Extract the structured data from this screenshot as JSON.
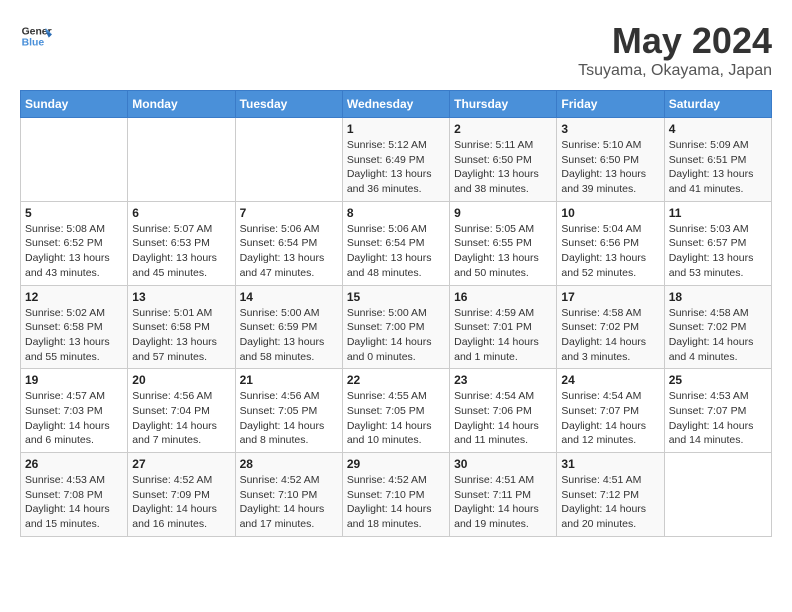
{
  "header": {
    "logo_line1": "General",
    "logo_line2": "Blue",
    "month": "May 2024",
    "location": "Tsuyama, Okayama, Japan"
  },
  "days_of_week": [
    "Sunday",
    "Monday",
    "Tuesday",
    "Wednesday",
    "Thursday",
    "Friday",
    "Saturday"
  ],
  "weeks": [
    [
      {
        "day": "",
        "info": ""
      },
      {
        "day": "",
        "info": ""
      },
      {
        "day": "",
        "info": ""
      },
      {
        "day": "1",
        "info": "Sunrise: 5:12 AM\nSunset: 6:49 PM\nDaylight: 13 hours\nand 36 minutes."
      },
      {
        "day": "2",
        "info": "Sunrise: 5:11 AM\nSunset: 6:50 PM\nDaylight: 13 hours\nand 38 minutes."
      },
      {
        "day": "3",
        "info": "Sunrise: 5:10 AM\nSunset: 6:50 PM\nDaylight: 13 hours\nand 39 minutes."
      },
      {
        "day": "4",
        "info": "Sunrise: 5:09 AM\nSunset: 6:51 PM\nDaylight: 13 hours\nand 41 minutes."
      }
    ],
    [
      {
        "day": "5",
        "info": "Sunrise: 5:08 AM\nSunset: 6:52 PM\nDaylight: 13 hours\nand 43 minutes."
      },
      {
        "day": "6",
        "info": "Sunrise: 5:07 AM\nSunset: 6:53 PM\nDaylight: 13 hours\nand 45 minutes."
      },
      {
        "day": "7",
        "info": "Sunrise: 5:06 AM\nSunset: 6:54 PM\nDaylight: 13 hours\nand 47 minutes."
      },
      {
        "day": "8",
        "info": "Sunrise: 5:06 AM\nSunset: 6:54 PM\nDaylight: 13 hours\nand 48 minutes."
      },
      {
        "day": "9",
        "info": "Sunrise: 5:05 AM\nSunset: 6:55 PM\nDaylight: 13 hours\nand 50 minutes."
      },
      {
        "day": "10",
        "info": "Sunrise: 5:04 AM\nSunset: 6:56 PM\nDaylight: 13 hours\nand 52 minutes."
      },
      {
        "day": "11",
        "info": "Sunrise: 5:03 AM\nSunset: 6:57 PM\nDaylight: 13 hours\nand 53 minutes."
      }
    ],
    [
      {
        "day": "12",
        "info": "Sunrise: 5:02 AM\nSunset: 6:58 PM\nDaylight: 13 hours\nand 55 minutes."
      },
      {
        "day": "13",
        "info": "Sunrise: 5:01 AM\nSunset: 6:58 PM\nDaylight: 13 hours\nand 57 minutes."
      },
      {
        "day": "14",
        "info": "Sunrise: 5:00 AM\nSunset: 6:59 PM\nDaylight: 13 hours\nand 58 minutes."
      },
      {
        "day": "15",
        "info": "Sunrise: 5:00 AM\nSunset: 7:00 PM\nDaylight: 14 hours\nand 0 minutes."
      },
      {
        "day": "16",
        "info": "Sunrise: 4:59 AM\nSunset: 7:01 PM\nDaylight: 14 hours\nand 1 minute."
      },
      {
        "day": "17",
        "info": "Sunrise: 4:58 AM\nSunset: 7:02 PM\nDaylight: 14 hours\nand 3 minutes."
      },
      {
        "day": "18",
        "info": "Sunrise: 4:58 AM\nSunset: 7:02 PM\nDaylight: 14 hours\nand 4 minutes."
      }
    ],
    [
      {
        "day": "19",
        "info": "Sunrise: 4:57 AM\nSunset: 7:03 PM\nDaylight: 14 hours\nand 6 minutes."
      },
      {
        "day": "20",
        "info": "Sunrise: 4:56 AM\nSunset: 7:04 PM\nDaylight: 14 hours\nand 7 minutes."
      },
      {
        "day": "21",
        "info": "Sunrise: 4:56 AM\nSunset: 7:05 PM\nDaylight: 14 hours\nand 8 minutes."
      },
      {
        "day": "22",
        "info": "Sunrise: 4:55 AM\nSunset: 7:05 PM\nDaylight: 14 hours\nand 10 minutes."
      },
      {
        "day": "23",
        "info": "Sunrise: 4:54 AM\nSunset: 7:06 PM\nDaylight: 14 hours\nand 11 minutes."
      },
      {
        "day": "24",
        "info": "Sunrise: 4:54 AM\nSunset: 7:07 PM\nDaylight: 14 hours\nand 12 minutes."
      },
      {
        "day": "25",
        "info": "Sunrise: 4:53 AM\nSunset: 7:07 PM\nDaylight: 14 hours\nand 14 minutes."
      }
    ],
    [
      {
        "day": "26",
        "info": "Sunrise: 4:53 AM\nSunset: 7:08 PM\nDaylight: 14 hours\nand 15 minutes."
      },
      {
        "day": "27",
        "info": "Sunrise: 4:52 AM\nSunset: 7:09 PM\nDaylight: 14 hours\nand 16 minutes."
      },
      {
        "day": "28",
        "info": "Sunrise: 4:52 AM\nSunset: 7:10 PM\nDaylight: 14 hours\nand 17 minutes."
      },
      {
        "day": "29",
        "info": "Sunrise: 4:52 AM\nSunset: 7:10 PM\nDaylight: 14 hours\nand 18 minutes."
      },
      {
        "day": "30",
        "info": "Sunrise: 4:51 AM\nSunset: 7:11 PM\nDaylight: 14 hours\nand 19 minutes."
      },
      {
        "day": "31",
        "info": "Sunrise: 4:51 AM\nSunset: 7:12 PM\nDaylight: 14 hours\nand 20 minutes."
      },
      {
        "day": "",
        "info": ""
      }
    ]
  ]
}
